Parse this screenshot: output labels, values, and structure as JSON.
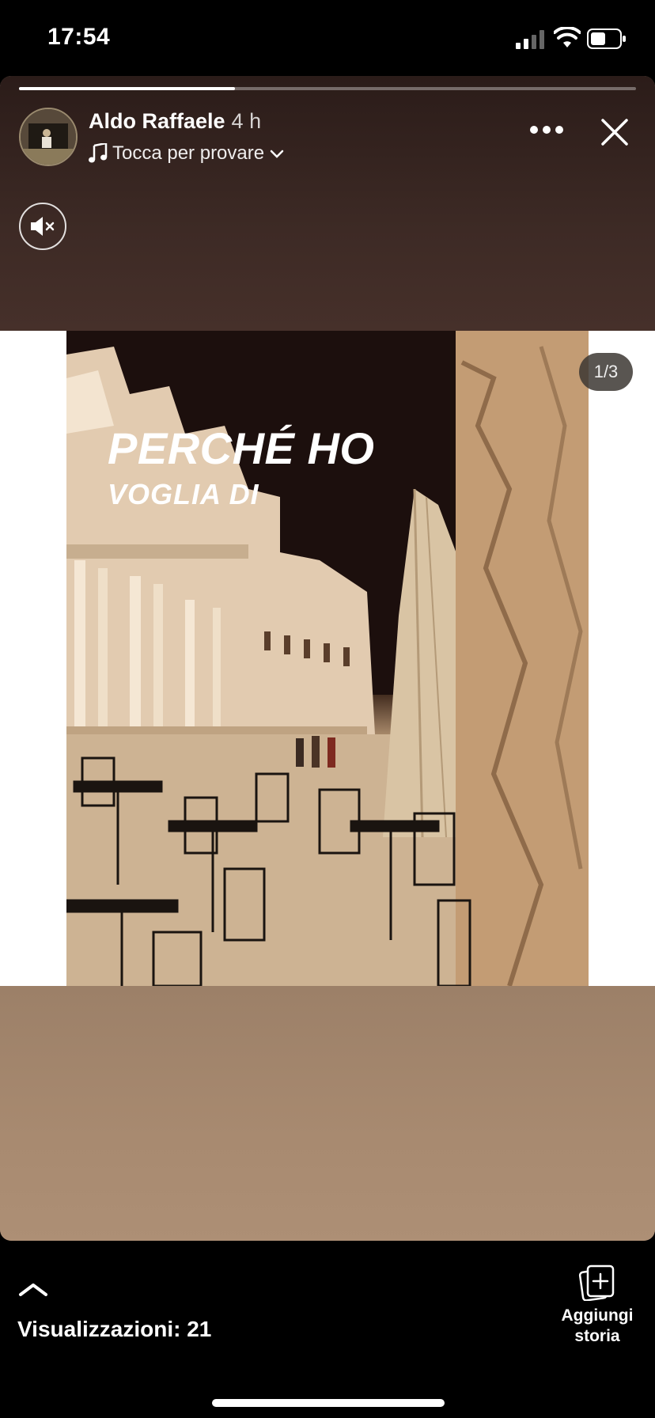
{
  "status_bar": {
    "time": "17:54"
  },
  "story": {
    "progress_fraction": 0.35,
    "user": {
      "name": "Aldo Raffaele",
      "time_ago": "4 h"
    },
    "music": {
      "label": "Tocca per provare"
    },
    "icons": [
      "music-note-icon",
      "chevron-down-icon",
      "more-icon",
      "close-icon",
      "mute-icon"
    ],
    "image": {
      "overlay_title": "PERCHÉ HO",
      "overlay_subtitle": "VOGLIA DI",
      "counter": "1/3"
    },
    "colors": {
      "top_band": "#3d2a25",
      "bottom_band": "#a88a70"
    }
  },
  "footer": {
    "views_label": "Visualizzazioni: 21",
    "add_story_label": "Aggiungi storia"
  }
}
